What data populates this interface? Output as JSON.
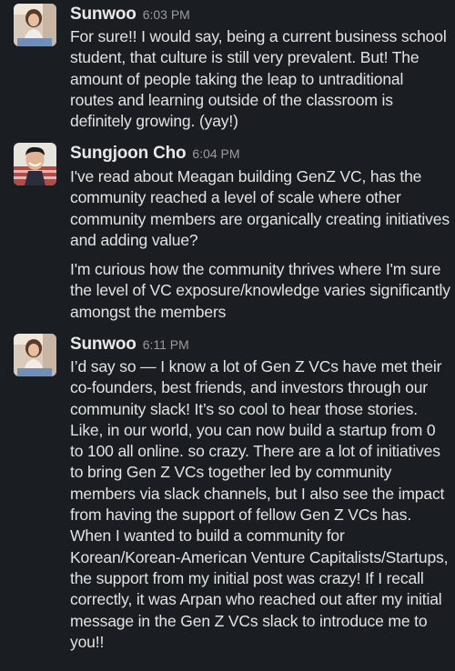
{
  "messages": [
    {
      "sender": "Sunwoo",
      "time": "6:03 PM",
      "avatar_icon": "user-photo-sunwoo",
      "paragraphs": [
        "For sure!! I would say, being a current business school student, that culture is still very prevalent. But! The amount of people taking the leap to untraditional routes and learning outside of the classroom is definitely growing. (yay!)"
      ]
    },
    {
      "sender": "Sungjoon Cho",
      "time": "6:04 PM",
      "avatar_icon": "user-photo-sungjoon",
      "paragraphs": [
        "I've read about Meagan building GenZ VC, has the community reached a level of scale where other community members are organically creating initiatives and adding value?",
        "I'm curious how the community thrives where I'm sure the level of VC exposure/knowledge varies significantly amongst the members"
      ]
    },
    {
      "sender": "Sunwoo",
      "time": "6:11 PM",
      "avatar_icon": "user-photo-sunwoo",
      "paragraphs": [
        "I’d say so — I know a lot of Gen Z VCs have met their co-founders, best friends, and investors through our community slack! It’s so cool to hear those stories. Like, in our world, you can now build a startup from 0 to 100 all online. so crazy. There are a lot of initiatives to bring Gen Z VCs together led by community members via slack channels, but I also see the impact from having the support of fellow Gen Z VCs has. When I wanted to build a community for Korean/Korean-American Venture Capitalists/Startups, the support from my initial post was crazy! If I recall correctly, it was Arpan who reached out after my initial message in the Gen Z VCs slack to introduce me to you!!"
      ]
    }
  ]
}
